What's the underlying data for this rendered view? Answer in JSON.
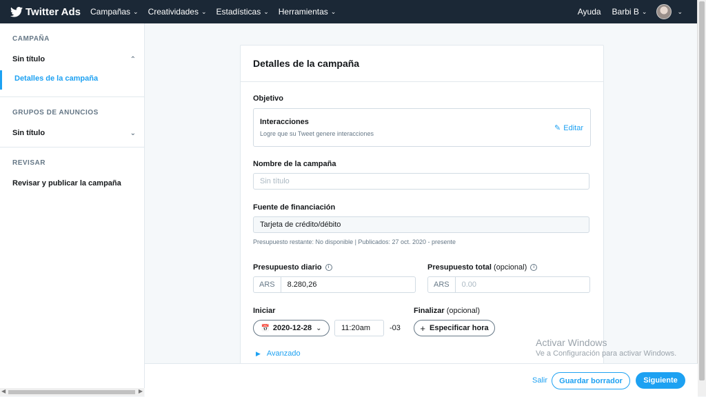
{
  "topbar": {
    "brand": "Twitter Ads",
    "nav": [
      "Campañas",
      "Creatividades",
      "Estadísticas",
      "Herramientas"
    ],
    "help": "Ayuda",
    "user": "Barbi B"
  },
  "sidebar": {
    "section1": "CAMPAÑA",
    "campaign_name": "Sin título",
    "campaign_sub": "Detalles de la campaña",
    "section2": "GRUPOS DE ANUNCIOS",
    "adgroup_name": "Sin título",
    "section3": "REVISAR",
    "review": "Revisar y publicar la campaña"
  },
  "card": {
    "title": "Detalles de la campaña",
    "objective_label": "Objetivo",
    "objective_title": "Interacciones",
    "objective_desc": "Logre que su Tweet genere interacciones",
    "edit": "Editar",
    "name_label": "Nombre de la campaña",
    "name_placeholder": "Sin título",
    "funding_label": "Fuente de financiación",
    "funding_value": "Tarjeta de crédito/débito",
    "funding_help": "Presupuesto restante: No disponible | Publicados: 27 oct. 2020 - presente",
    "daily_label": "Presupuesto diario",
    "daily_currency": "ARS",
    "daily_value": "8.280,26",
    "total_label": "Presupuesto total",
    "total_opt": "(opcional)",
    "total_currency": "ARS",
    "total_placeholder": "0.00",
    "start_label": "Iniciar",
    "start_date": "2020-12-28",
    "start_time": "11:20am",
    "tz": "-03",
    "end_label": "Finalizar",
    "end_opt": "(opcional)",
    "end_button": "Especificar hora",
    "advanced": "Avanzado"
  },
  "footer": {
    "exit": "Salir",
    "save_draft": "Guardar borrador",
    "next": "Siguiente"
  },
  "watermark": {
    "line1": "Activar Windows",
    "line2": "Ve a Configuración para activar Windows."
  },
  "colors": {
    "accent": "#1da1f2",
    "nav_bg": "#1b2836"
  }
}
